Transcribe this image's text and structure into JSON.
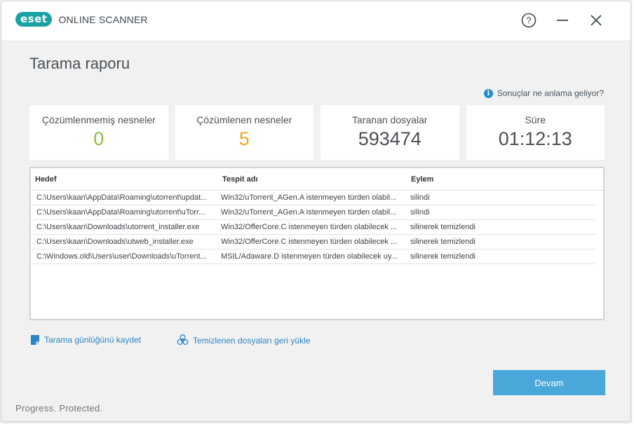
{
  "app": {
    "brand_badge": "eset",
    "brand_name": "ONLINE SCANNER",
    "tagline": "Progress. Protected."
  },
  "titlebar": {
    "help_label": "?",
    "icons": [
      "help-icon",
      "minimize-icon",
      "close-icon"
    ]
  },
  "page": {
    "title": "Tarama raporu",
    "info_link": "Sonuçlar ne anlama geliyor?"
  },
  "stats": [
    {
      "label": "Çözümlenmemiş nesneler",
      "value": "0",
      "color": "#8cbf3f"
    },
    {
      "label": "Çözümlenen nesneler",
      "value": "5",
      "color": "#f2a81d"
    },
    {
      "label": "Taranan dosyalar",
      "value": "593474",
      "color": "#4a5157"
    },
    {
      "label": "Süre",
      "value": "01:12:13",
      "color": "#4a5157"
    }
  ],
  "table": {
    "headers": [
      "Hedef",
      "Tespit adı",
      "Eylem"
    ],
    "rows": [
      [
        "C:\\Users\\kaan\\AppData\\Roaming\\utorrent\\updat...",
        "Win32/uTorrent_AGen.A istenmeyen türden olabil...",
        "silindi"
      ],
      [
        "C:\\Users\\kaan\\AppData\\Roaming\\utorrent\\uTorr...",
        "Win32/uTorrent_AGen.A istenmeyen türden olabil...",
        "silindi"
      ],
      [
        "C:\\Users\\kaan\\Downloads\\utorrent_installer.exe",
        "Win32/OfferCore.C istenmeyen türden olabilecek ...",
        "silinerek temizlendi"
      ],
      [
        "C:\\Users\\kaan\\Downloads\\utweb_installer.exe",
        "Win32/OfferCore.C istenmeyen türden olabilecek ...",
        "silinerek temizlendi"
      ],
      [
        "C:\\Windows.old\\Users\\user\\Downloads\\uTorrent...",
        "MSIL/Adaware.D istenmeyen türden olabilecek uy...",
        "silinerek temizlendi"
      ]
    ]
  },
  "actions": {
    "save_log": "Tarama günlüğünü kaydet",
    "restore_files": "Temizlenen dosyaları geri yükle",
    "continue": "Devam"
  },
  "colors": {
    "accent": "#4aa7d9",
    "brand": "#1aa1a3",
    "link": "#2a86c4"
  }
}
